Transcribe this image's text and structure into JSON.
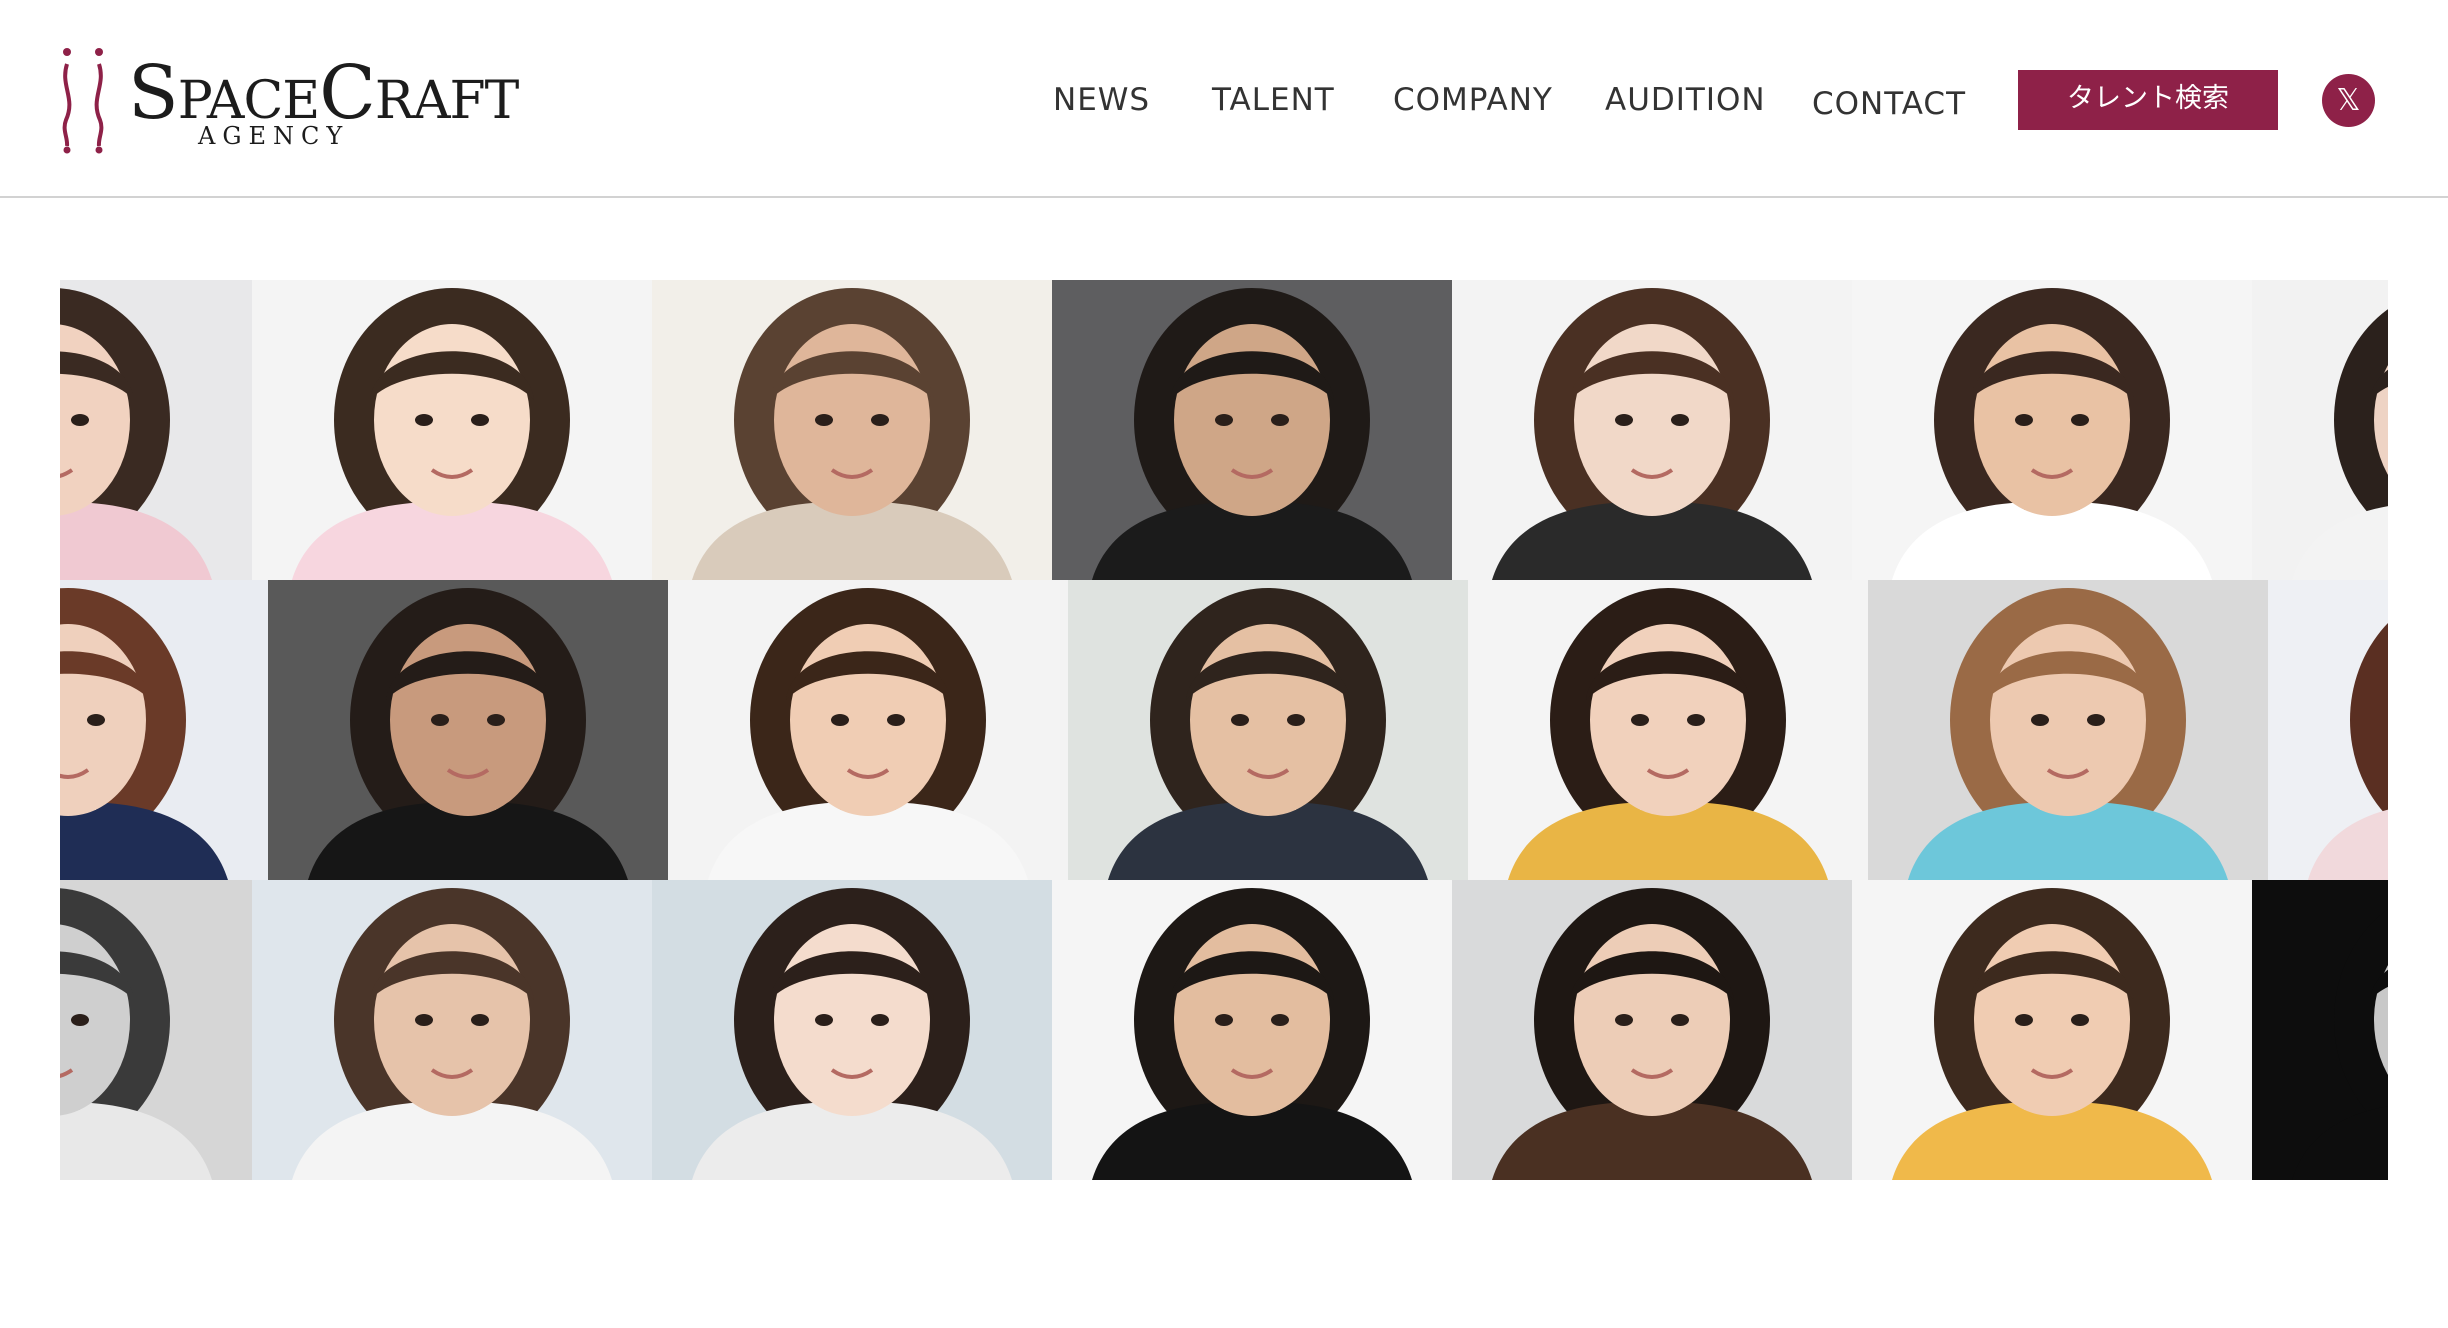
{
  "brand": {
    "name_part1_initial": "S",
    "name_part1_rest": "PACE",
    "name_part2_initial": "C",
    "name_part2_rest": "RAFT",
    "subtitle": "AGENCY",
    "accent_color": "#8e2148"
  },
  "nav": {
    "items": [
      {
        "label": "NEWS"
      },
      {
        "label": "TALENT"
      },
      {
        "label": "COMPANY"
      },
      {
        "label": "AUDITION"
      },
      {
        "label": "CONTACT"
      }
    ],
    "search_button_label": "タレント検索",
    "social_label": "𝕏"
  },
  "talent_grid": {
    "rows": [
      {
        "tiles": [
          {
            "bg": "#e8e8ea",
            "skin": "#f1d2c0",
            "hair": "#3a2a22",
            "top": "#f0c9d2"
          },
          {
            "bg": "#f4f4f4",
            "skin": "#f6dcc9",
            "hair": "#3b2b20",
            "top": "#f7d6df"
          },
          {
            "bg": "#f2efe9",
            "skin": "#dfb69a",
            "hair": "#5a4232",
            "top": "#d9cbbb"
          },
          {
            "bg": "#5e5e60",
            "skin": "#cfa687",
            "hair": "#1f1a17",
            "top": "#1b1b1b"
          },
          {
            "bg": "#f3f3f3",
            "skin": "#f1d8c8",
            "hair": "#4a3023",
            "top": "#2a2a2a"
          },
          {
            "bg": "#f5f5f5",
            "skin": "#e9c2a4",
            "hair": "#3a2820",
            "top": "#ffffff"
          },
          {
            "bg": "#f2f2f2",
            "skin": "#eed3c4",
            "hair": "#2b211c",
            "top": "#f3f3f3"
          }
        ]
      },
      {
        "tiles": [
          {
            "bg": "#e9ecf2",
            "skin": "#efd0bd",
            "hair": "#6a3a28",
            "top": "#1f2d55"
          },
          {
            "bg": "#595959",
            "skin": "#c89a7d",
            "hair": "#241c18",
            "top": "#161616"
          },
          {
            "bg": "#f3f3f3",
            "skin": "#f0cdb4",
            "hair": "#3b2619",
            "top": "#f7f7f7"
          },
          {
            "bg": "#dfe3e0",
            "skin": "#e5c0a3",
            "hair": "#2f241d",
            "top": "#2c3340"
          },
          {
            "bg": "#f4f4f4",
            "skin": "#f1d1bc",
            "hair": "#2b1d16",
            "top": "#e9b545"
          },
          {
            "bg": "#d9d9d9",
            "skin": "#edc9b0",
            "hair": "#9a6a46",
            "top": "#6dc7da"
          },
          {
            "bg": "#eef0f4",
            "skin": "#f2d6c8",
            "hair": "#5a2f22",
            "top": "#f1d9dc"
          }
        ]
      },
      {
        "tiles": [
          {
            "bg": "#d6d6d6",
            "skin": "#cfcfcf",
            "hair": "#3a3a3a",
            "top": "#e8e8e8"
          },
          {
            "bg": "#dfe6ec",
            "skin": "#e6c3aa",
            "hair": "#4a3529",
            "top": "#f4f4f4"
          },
          {
            "bg": "#d3dde3",
            "skin": "#f4dccd",
            "hair": "#2c201b",
            "top": "#ececec"
          },
          {
            "bg": "#f5f5f5",
            "skin": "#e3bd9f",
            "hair": "#1d1815",
            "top": "#141414"
          },
          {
            "bg": "#d9dadb",
            "skin": "#edcdb7",
            "hair": "#1e1713",
            "top": "#4a3022"
          },
          {
            "bg": "#f5f5f5",
            "skin": "#f0ccb2",
            "hair": "#3d2a1e",
            "top": "#f0b94a"
          },
          {
            "bg": "#0d0d0d",
            "skin": "#c8c8c8",
            "hair": "#0d0d0d",
            "top": "#0d0d0d"
          }
        ]
      }
    ]
  }
}
